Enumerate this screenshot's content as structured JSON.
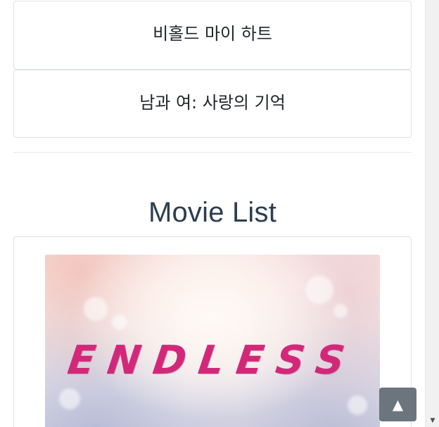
{
  "related_titles": [
    {
      "title": "비홀드 마이 하트"
    },
    {
      "title": "남과 여: 사랑의 기억"
    }
  ],
  "movie_list": {
    "heading": "Movie List",
    "items": [
      {
        "poster_text": "ENDLESS"
      }
    ]
  },
  "scroll_top_button": {
    "label": "▲",
    "color": "#6c757d"
  },
  "scrollbar": {
    "down_arrow": "▼"
  },
  "colors": {
    "heading": "#2c3e50",
    "poster_title": "#d2287a",
    "border": "#dee2e6"
  }
}
